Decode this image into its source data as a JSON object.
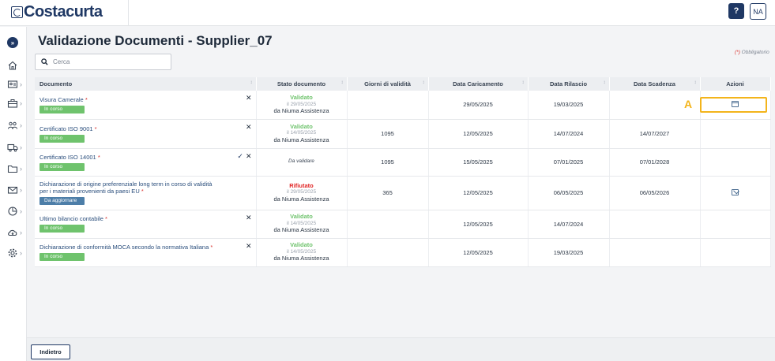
{
  "header": {
    "logo_text": "Costacurta",
    "help_label": "?",
    "user_initials": "NA"
  },
  "sidebar": {
    "expand_label": "»",
    "items": [
      {
        "icon": "home-icon",
        "has_submenu": false
      },
      {
        "icon": "id-card-icon",
        "has_submenu": true
      },
      {
        "icon": "briefcase-icon",
        "has_submenu": true
      },
      {
        "icon": "users-icon",
        "has_submenu": true
      },
      {
        "icon": "truck-icon",
        "has_submenu": true
      },
      {
        "icon": "folder-icon",
        "has_submenu": true
      },
      {
        "icon": "mail-icon",
        "has_submenu": true
      },
      {
        "icon": "chart-icon",
        "has_submenu": true
      },
      {
        "icon": "cloud-download-icon",
        "has_submenu": true
      },
      {
        "icon": "gear-icon",
        "has_submenu": true
      }
    ]
  },
  "page": {
    "title": "Validazione Documenti - Supplier_07",
    "required_star": "(*)",
    "required_text": "Obbligatorio",
    "search_placeholder": "Cerca"
  },
  "table": {
    "columns": [
      "Documento",
      "Stato documento",
      "Giorni di validità",
      "Data Caricamento",
      "Data Rilascio",
      "Data Scadenza",
      "Azioni"
    ],
    "rows": [
      {
        "name": "Visura Camerale",
        "required": "*",
        "badge": "In corso",
        "status": "Validato",
        "status_date": "il 29/05/2025",
        "status_by": "da Niuma Assistenza",
        "giorni": "",
        "caricamento": "29/05/2025",
        "rilascio": "19/03/2025",
        "scadenza": "",
        "action": "calendar-icon"
      },
      {
        "name": "Certificato ISO 9001",
        "required": "*",
        "badge": "In corso",
        "status": "Validato",
        "status_date": "il 14/05/2025",
        "status_by": "da Niuma Assistenza",
        "giorni": "1095",
        "caricamento": "12/05/2025",
        "rilascio": "14/07/2024",
        "scadenza": "14/07/2027",
        "action": ""
      },
      {
        "name": "Certificato ISO 14001",
        "required": "*",
        "badge": "In corso",
        "status": "Da validare",
        "status_date": "",
        "status_by": "",
        "giorni": "1095",
        "caricamento": "15/05/2025",
        "rilascio": "07/01/2025",
        "scadenza": "07/01/2028",
        "action": ""
      },
      {
        "name": "Dichiarazione di origine preferenziale long term in corso di validità per i materiali provenienti da paesi EU",
        "required": "*",
        "badge": "Da aggiornare",
        "status": "Rifiutato",
        "status_date": "il 29/05/2025",
        "status_by": "da Niuma Assistenza",
        "giorni": "365",
        "caricamento": "12/05/2025",
        "rilascio": "06/05/2025",
        "scadenza": "06/05/2026",
        "action": "mail-icon"
      },
      {
        "name": "Ultimo bilancio contabile",
        "required": "*",
        "badge": "In corso",
        "status": "Validato",
        "status_date": "il 14/05/2025",
        "status_by": "da Niuma Assistenza",
        "giorni": "",
        "caricamento": "12/05/2025",
        "rilascio": "14/07/2024",
        "scadenza": "",
        "action": ""
      },
      {
        "name": "Dichiarazione di conformità MOCA secondo la normativa Italiana",
        "required": "*",
        "badge": "In corso",
        "status": "Validato",
        "status_date": "il 14/05/2025",
        "status_by": "da Niuma Assistenza",
        "giorni": "",
        "caricamento": "12/05/2025",
        "rilascio": "19/03/2025",
        "scadenza": "",
        "action": ""
      }
    ]
  },
  "annotation": {
    "label": "A",
    "color": "#f3b41b"
  },
  "footer": {
    "back_label": "Indietro"
  },
  "colors": {
    "brand": "#1f3864",
    "validated": "#6fc36d",
    "rejected": "#e02424",
    "badge_update": "#4d7ea8"
  }
}
